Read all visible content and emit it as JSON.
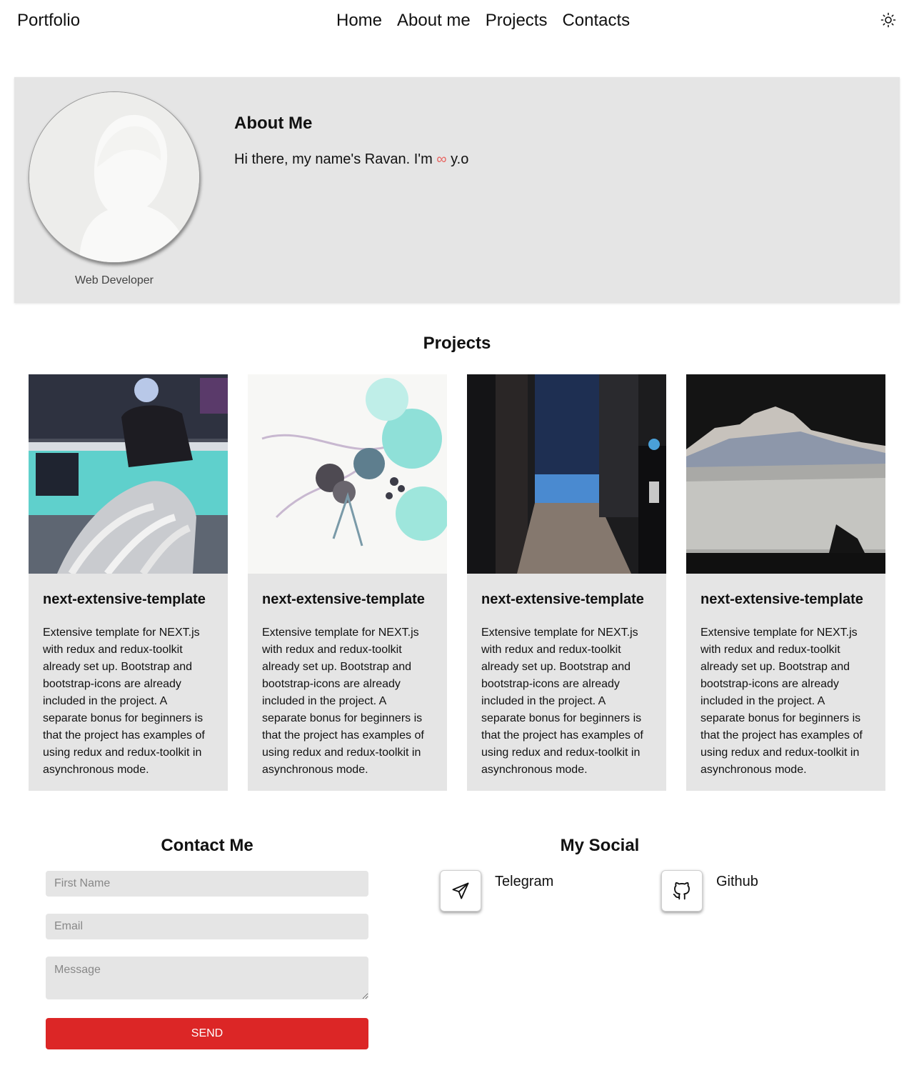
{
  "header": {
    "brand": "Portfolio",
    "nav": [
      "Home",
      "About me",
      "Projects",
      "Contacts"
    ],
    "theme_icon": "sun-icon"
  },
  "about": {
    "role": "Web Developer",
    "title": "About Me",
    "intro_before": "Hi there, my name's Ravan. I'm",
    "intro_symbol": "∞",
    "intro_after": "y.o",
    "symbol_color": "#e8635f"
  },
  "projects": {
    "title": "Projects",
    "items": [
      {
        "title": "next-extensive-template",
        "description": "Extensive template for NEXT.js with redux and redux-toolkit already set up. Bootstrap and bootstrap-icons are already included in the project. A separate bonus for beginners is that the project has examples of using redux and redux-toolkit in asynchronous mode."
      },
      {
        "title": "next-extensive-template",
        "description": "Extensive template for NEXT.js with redux and redux-toolkit already set up. Bootstrap and bootstrap-icons are already included in the project. A separate bonus for beginners is that the project has examples of using redux and redux-toolkit in asynchronous mode."
      },
      {
        "title": "next-extensive-template",
        "description": "Extensive template for NEXT.js with redux and redux-toolkit already set up. Bootstrap and bootstrap-icons are already included in the project. A separate bonus for beginners is that the project has examples of using redux and redux-toolkit in asynchronous mode."
      },
      {
        "title": "next-extensive-template",
        "description": "Extensive template for NEXT.js with redux and redux-toolkit already set up. Bootstrap and bootstrap-icons are already included in the project. A separate bonus for beginners is that the project has examples of using redux and redux-toolkit in asynchronous mode."
      }
    ]
  },
  "contact": {
    "title": "Contact Me",
    "first_name_placeholder": "First Name",
    "email_placeholder": "Email",
    "message_placeholder": "Message",
    "send_label": "SEND",
    "send_color": "#dc2626"
  },
  "social": {
    "title": "My Social",
    "items": [
      {
        "label": "Telegram",
        "icon": "telegram-icon"
      },
      {
        "label": "Github",
        "icon": "github-icon"
      }
    ]
  }
}
